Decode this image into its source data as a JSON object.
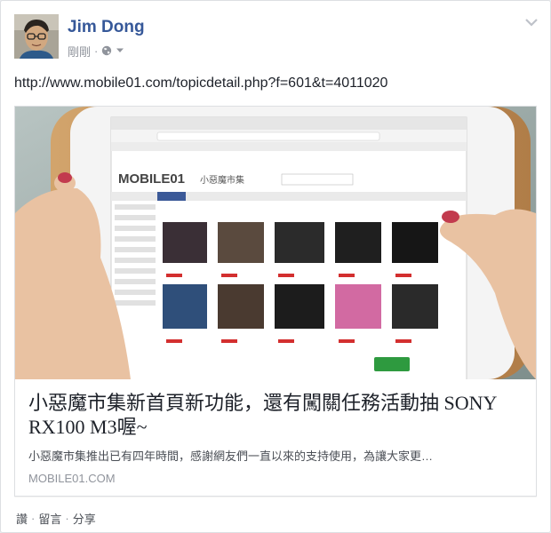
{
  "post": {
    "author": "Jim Dong",
    "timestamp": "剛剛",
    "meta_separator": "·",
    "privacy_icon": "globe-icon",
    "options_icon": "chevron-down-icon",
    "link_text": "http://www.mobile01.com/topicdetail.php?f=601&t=4011020"
  },
  "card": {
    "title": "小惡魔市集新首頁新功能，還有闖關任務活動抽 SONY RX100 M3喔~",
    "description": "小惡魔市集推出已有四年時間，感謝網友們一直以來的支持使用，為讓大家更…",
    "domain": "MOBILE01.COM",
    "image_screen_brand": "MOBILE01",
    "image_screen_subtitle": "小惡魔市集"
  },
  "actions": {
    "like": "讚",
    "comment": "留言",
    "share": "分享",
    "separator": "·"
  },
  "colors": {
    "author": "#365899",
    "link_text": "#1d2129",
    "muted": "#90949c",
    "accent": "#3b5998"
  }
}
